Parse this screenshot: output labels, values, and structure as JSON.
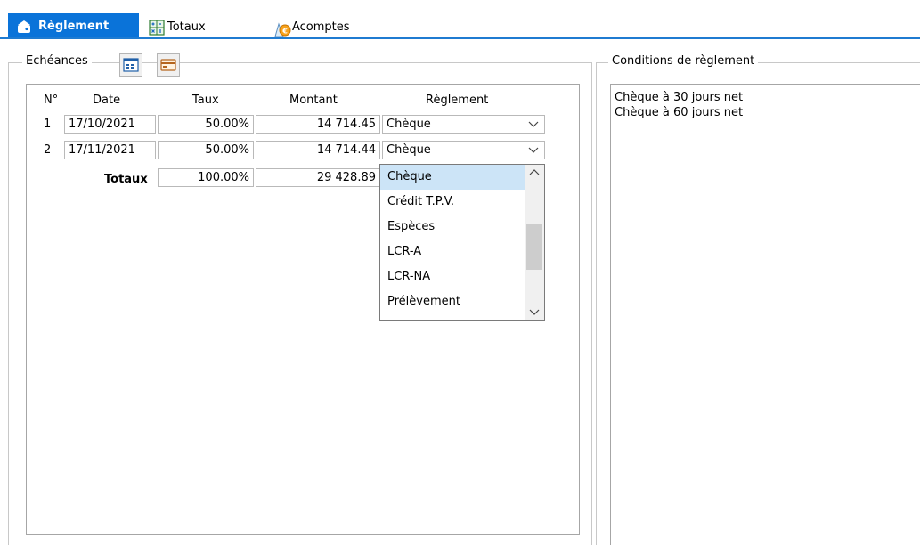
{
  "tabs": [
    {
      "label": "Règlement",
      "active": true
    },
    {
      "label": "Totaux"
    },
    {
      "label": "Acomptes"
    }
  ],
  "echeances": {
    "legend": "Echéances",
    "headers": {
      "num": "N°",
      "date": "Date",
      "taux": "Taux",
      "montant": "Montant",
      "reglement": "Règlement"
    },
    "rows": [
      {
        "num": "1",
        "date": "17/10/2021",
        "taux": "50.00%",
        "montant": "14 714.45",
        "reglement": "Chèque"
      },
      {
        "num": "2",
        "date": "17/11/2021",
        "taux": "50.00%",
        "montant": "14 714.44",
        "reglement": "Chèque"
      }
    ],
    "totals": {
      "label": "Totaux",
      "taux": "100.00%",
      "montant": "29 428.89"
    }
  },
  "dropdown": {
    "options": [
      "Chèque",
      "Crédit T.P.V.",
      "Espèces",
      "LCR-A",
      "LCR-NA",
      "Prélèvement"
    ],
    "selected_index": 0
  },
  "conditions": {
    "legend": "Conditions de règlement",
    "lines": [
      "Chèque à 30 jours net",
      "Chèque à 60 jours net"
    ]
  },
  "colors": {
    "tab_active": "#0a73d9",
    "selection": "#cce4f7"
  }
}
